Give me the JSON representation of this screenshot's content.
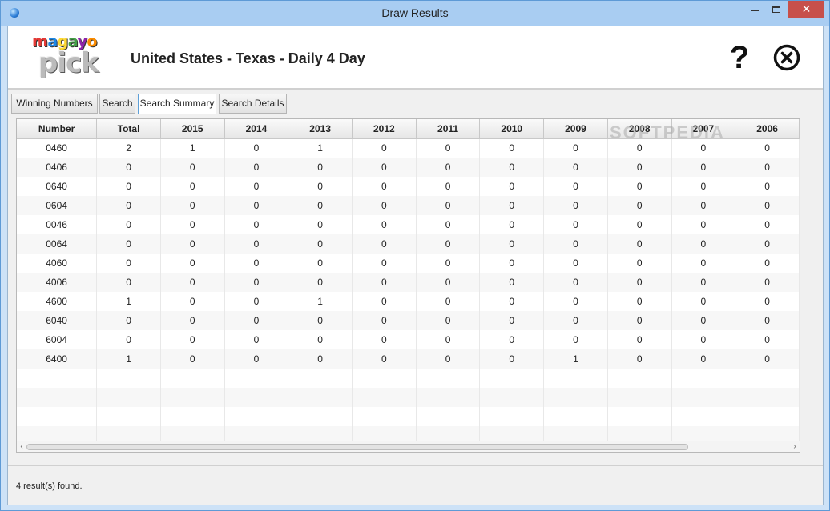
{
  "window": {
    "title": "Draw Results"
  },
  "header": {
    "title": "United States - Texas - Daily 4 Day",
    "help_label": "?"
  },
  "logo": {
    "line1": "magayo",
    "line2": "pick",
    "colors": [
      "#e53935",
      "#1e88e5",
      "#fdd835",
      "#43a047",
      "#8e24aa",
      "#fb8c00"
    ]
  },
  "tabs": [
    {
      "label": "Winning Numbers",
      "active": false
    },
    {
      "label": "Search",
      "active": false
    },
    {
      "label": "Search Summary",
      "active": true
    },
    {
      "label": "Search Details",
      "active": false
    }
  ],
  "table": {
    "columns": [
      "Number",
      "Total",
      "2015",
      "2014",
      "2013",
      "2012",
      "2011",
      "2010",
      "2009",
      "2008",
      "2007",
      "2006"
    ],
    "rows": [
      [
        "0460",
        "2",
        "1",
        "0",
        "1",
        "0",
        "0",
        "0",
        "0",
        "0",
        "0",
        "0"
      ],
      [
        "0406",
        "0",
        "0",
        "0",
        "0",
        "0",
        "0",
        "0",
        "0",
        "0",
        "0",
        "0"
      ],
      [
        "0640",
        "0",
        "0",
        "0",
        "0",
        "0",
        "0",
        "0",
        "0",
        "0",
        "0",
        "0"
      ],
      [
        "0604",
        "0",
        "0",
        "0",
        "0",
        "0",
        "0",
        "0",
        "0",
        "0",
        "0",
        "0"
      ],
      [
        "0046",
        "0",
        "0",
        "0",
        "0",
        "0",
        "0",
        "0",
        "0",
        "0",
        "0",
        "0"
      ],
      [
        "0064",
        "0",
        "0",
        "0",
        "0",
        "0",
        "0",
        "0",
        "0",
        "0",
        "0",
        "0"
      ],
      [
        "4060",
        "0",
        "0",
        "0",
        "0",
        "0",
        "0",
        "0",
        "0",
        "0",
        "0",
        "0"
      ],
      [
        "4006",
        "0",
        "0",
        "0",
        "0",
        "0",
        "0",
        "0",
        "0",
        "0",
        "0",
        "0"
      ],
      [
        "4600",
        "1",
        "0",
        "0",
        "1",
        "0",
        "0",
        "0",
        "0",
        "0",
        "0",
        "0"
      ],
      [
        "6040",
        "0",
        "0",
        "0",
        "0",
        "0",
        "0",
        "0",
        "0",
        "0",
        "0",
        "0"
      ],
      [
        "6004",
        "0",
        "0",
        "0",
        "0",
        "0",
        "0",
        "0",
        "0",
        "0",
        "0",
        "0"
      ],
      [
        "6400",
        "1",
        "0",
        "0",
        "0",
        "0",
        "0",
        "0",
        "1",
        "0",
        "0",
        "0"
      ]
    ],
    "empty_rows": 4,
    "watermark": "SOFTPEDIA"
  },
  "status": {
    "text": "4 result(s) found."
  },
  "colors": {
    "active_tab_border": "#5ea0d8",
    "close_button": "#c7504b"
  }
}
